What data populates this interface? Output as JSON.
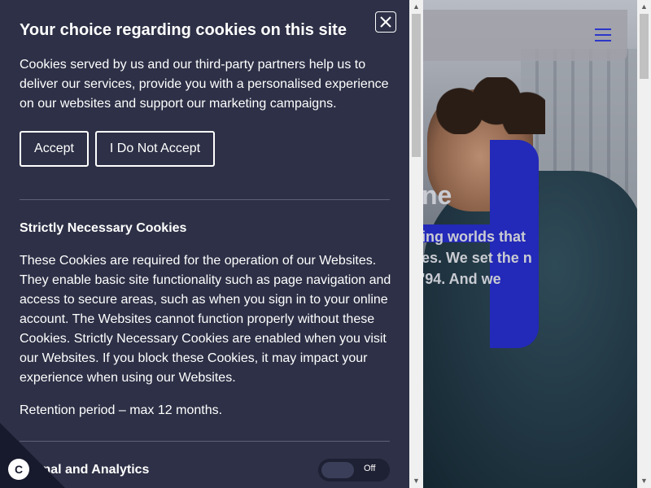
{
  "site": {
    "heading_fragment": "ne",
    "paragraph_fragment": "ing worlds that es. We set the n '94. And we",
    "menu_icon": "hamburger-icon"
  },
  "cookie_panel": {
    "title": "Your choice regarding cookies on this site",
    "intro": "Cookies served by us and our third-party partners help us to deliver our services, provide you with a personalised experience on our websites and support our marketing campaigns.",
    "accept_label": "Accept",
    "reject_label": "I Do Not Accept",
    "close_icon": "close-icon",
    "sections": [
      {
        "title": "Strictly Necessary Cookies",
        "text": "These Cookies are required for the operation of our Websites. They enable basic site functionality such as page navigation and access to secure areas, such as when you sign in to your online account. The Websites cannot function properly without these Cookies. Strictly Necessary Cookies are enabled when you visit our Websites. If you block these Cookies, it may impact your experience when using our Websites.",
        "retention": "Retention period – max 12 months."
      },
      {
        "title": "ctional and Analytics",
        "toggle_label": "Off",
        "toggle_on": false
      }
    ]
  },
  "cookie_badge": {
    "icon": "cookie-icon",
    "letter": "C"
  },
  "colors": {
    "panel_bg": "#2d3046",
    "accent_blue": "#2329b8",
    "menu_blue": "#2c36c8",
    "divider": "#5d6078"
  }
}
